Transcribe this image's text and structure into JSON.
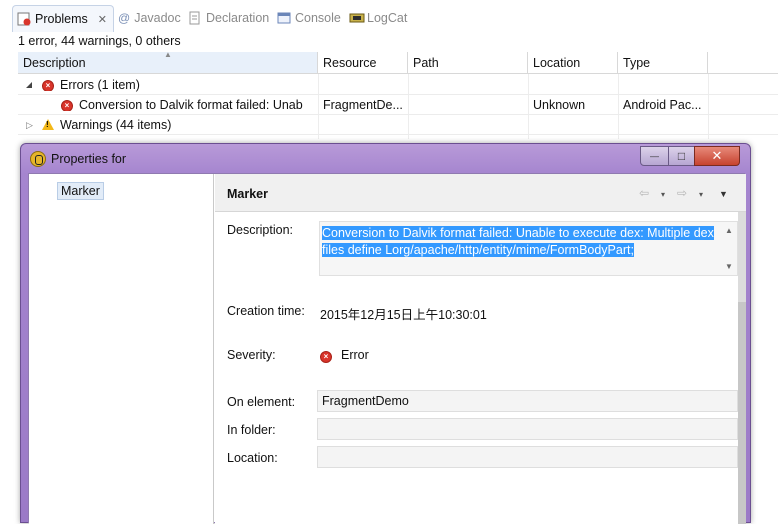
{
  "tabs": [
    {
      "label": "Problems",
      "icon": "problems-icon",
      "active": true
    },
    {
      "label": "Javadoc",
      "icon": "at-icon",
      "active": false
    },
    {
      "label": "Declaration",
      "icon": "declaration-icon",
      "active": false
    },
    {
      "label": "Console",
      "icon": "console-icon",
      "active": false
    },
    {
      "label": "LogCat",
      "icon": "logcat-icon",
      "active": false
    }
  ],
  "tab_close_glyph": "✕",
  "summary": "1 error, 44 warnings, 0 others",
  "columns": [
    "Description",
    "Resource",
    "Path",
    "Location",
    "Type"
  ],
  "errors_group": {
    "label": "Errors (1 item)",
    "expander": "◢"
  },
  "error_row": {
    "description": "Conversion to Dalvik format failed: Unab",
    "resource": "FragmentDe...",
    "path": "",
    "location": "Unknown",
    "type": "Android Pac..."
  },
  "warnings_group": {
    "label": "Warnings (44 items)",
    "expander": "▷"
  },
  "dialog": {
    "title": "Properties for",
    "tree": [
      "Marker"
    ],
    "section_title": "Marker",
    "nav": {
      "back": "⇦",
      "forward": "⇨",
      "dropdown": "▾",
      "menu": "▼"
    },
    "fields": {
      "description_label": "Description:",
      "description_value": "Conversion to Dalvik format failed: Unable to execute dex: Multiple dex files define Lorg/apache/http/entity/mime/FormBodyPart;",
      "creation_label": "Creation time:",
      "creation_value": "2015年12月15日上午10:30:01",
      "severity_label": "Severity:",
      "severity_value": "Error",
      "on_element_label": "On element:",
      "on_element_value": "FragmentDemo",
      "in_folder_label": "In folder:",
      "in_folder_value": "",
      "location_label": "Location:",
      "location_value": ""
    },
    "window_buttons": {
      "minimize": "—",
      "maximize": "□",
      "close": "✕"
    }
  },
  "colors": {
    "error": "#d9352b",
    "warning": "#f3b818",
    "dialog_frame": "#a585cf",
    "selection": "#3399ff"
  }
}
